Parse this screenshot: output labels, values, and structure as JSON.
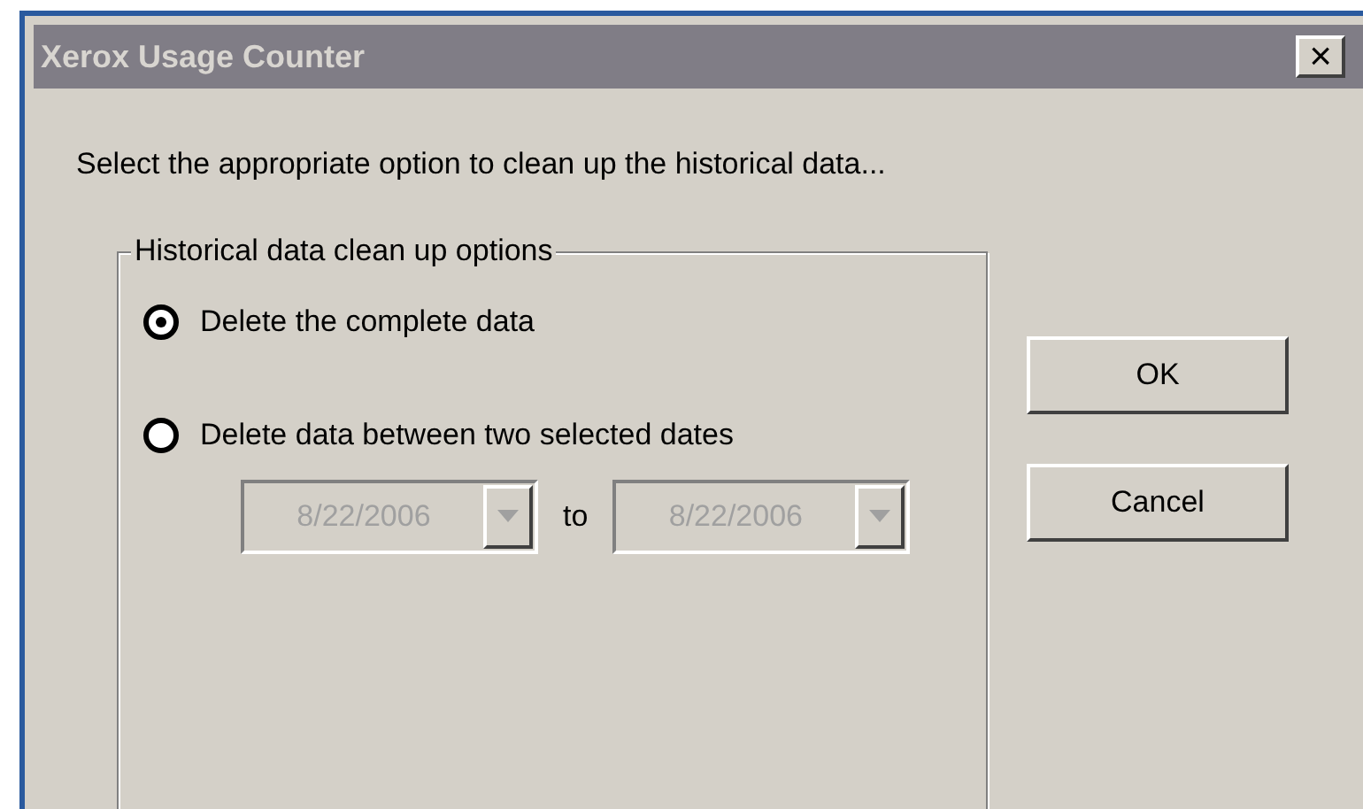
{
  "window": {
    "title": "Xerox Usage Counter",
    "close_button": "×"
  },
  "instruction": "Select the appropriate option to clean up the historical data...",
  "group": {
    "title": "Historical data clean up options",
    "options": [
      {
        "label": "Delete the complete data",
        "selected": true
      },
      {
        "label": "Delete data between two selected dates",
        "selected": false
      }
    ],
    "date_range": {
      "from": {
        "value": "8/22/2006",
        "disabled": true
      },
      "separator": "to",
      "to": {
        "value": "8/22/2006",
        "disabled": true
      }
    }
  },
  "buttons": [
    {
      "label": "OK"
    },
    {
      "label": "Cancel"
    }
  ]
}
